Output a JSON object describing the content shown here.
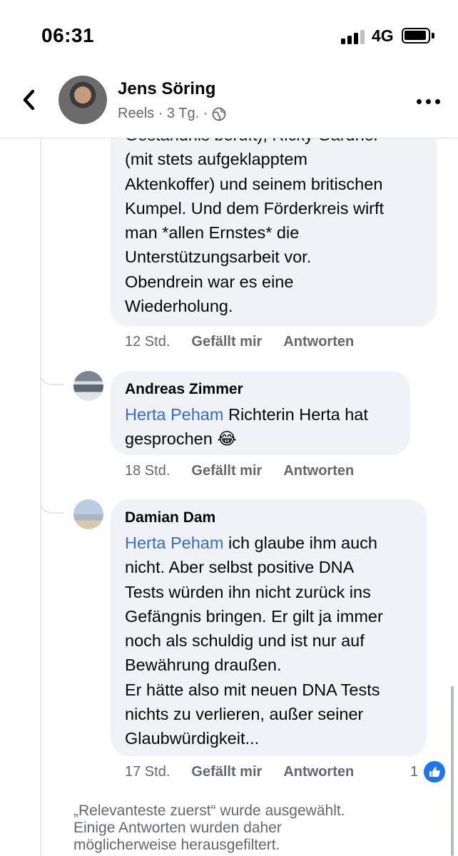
{
  "status": {
    "time": "06:31",
    "network": "4G"
  },
  "header": {
    "name": "Jens Söring",
    "sub": "Reels · 3 Tg. ·",
    "back_icon": "chevron-left-icon",
    "more_icon": "more-horizontal-icon",
    "privacy_icon": "globe-icon"
  },
  "comments": [
    {
      "author": "",
      "text_partial_top": "Geständnis beruft), Ricky Gardner",
      "lines": [
        "(mit stets aufgeklapptem",
        "Aktenkoffer) und seinem britischen",
        "Kumpel. Und dem Förderkreis wirft",
        "man *allen Ernstes* die",
        "Unterstützungsarbeit vor.",
        "Obendrein war es eine",
        "Wiederholung."
      ],
      "time": "12 Std.",
      "like_label": "Gefällt mir",
      "reply_label": "Antworten"
    },
    {
      "author": "Andreas Zimmer",
      "mention": "Herta Peham",
      "text_after_mention": " Richterin Herta hat",
      "text_line2": "gesprochen 😂",
      "time": "18 Std.",
      "like_label": "Gefällt mir",
      "reply_label": "Antworten"
    },
    {
      "author": "Damian Dam",
      "mention": "Herta Peham",
      "text_after_mention": " ich glaube ihm auch",
      "lines": [
        "nicht. Aber selbst positive DNA",
        "Tests würden ihn nicht zurück ins",
        "Gefängnis bringen. Er gilt ja immer",
        "noch als schuldig und ist nur auf",
        "Bewährung draußen.",
        "Er hätte also mit neuen DNA Tests",
        "nichts zu verlieren, außer seiner",
        "Glaubwürdigkeit..."
      ],
      "time": "17 Std.",
      "like_label": "Gefällt mir",
      "reply_label": "Antworten",
      "like_count": "1"
    }
  ],
  "notice": {
    "line1": "„Relevanteste zuerst“ wurde ausgewählt.",
    "line2": "Einige Antworten wurden daher",
    "line3": "möglicherweise herausgefiltert."
  },
  "colors": {
    "bubble": "#f0f2f5",
    "mention": "#2f6ed3",
    "meta": "#65676b",
    "like_blue": "#1877f2"
  }
}
